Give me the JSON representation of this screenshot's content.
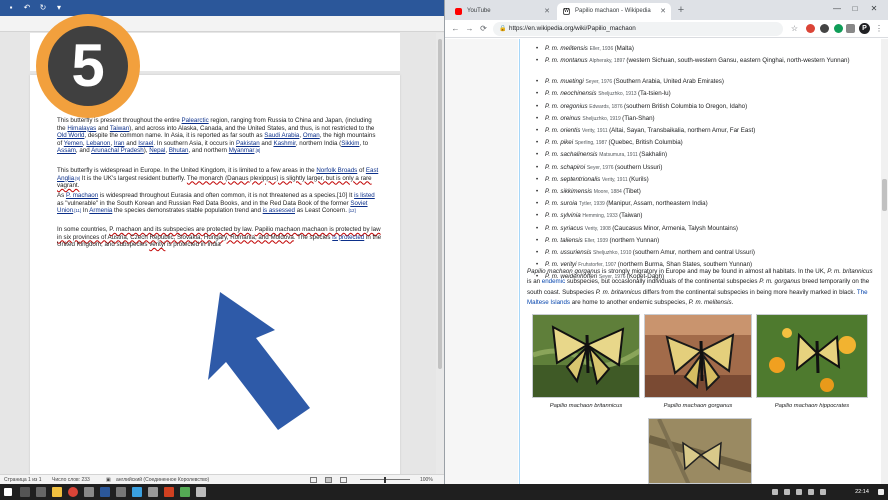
{
  "word": {
    "statusbar": {
      "page": "Страница 1 из 1",
      "words": "Число слов: 233",
      "language": "английский (Соединенное Королевство)",
      "zoom": "100%"
    },
    "paragraphs": [
      [
        {
          "t": "This butterfly is present throughout the entire "
        },
        {
          "t": "Palearctic",
          "c": "lnk"
        },
        {
          "t": " region, ranging from Russia to China and Japan, (including the "
        },
        {
          "t": "Himalayas",
          "c": "lnk"
        },
        {
          "t": " and "
        },
        {
          "t": "Taiwan",
          "c": "lnk"
        },
        {
          "t": "), and across into Alaska, Canada, and the United States, and thus, is not restricted to the "
        },
        {
          "t": "Old World",
          "c": "lnk"
        },
        {
          "t": ", despite the common name. In Asia, it is reported as far south as "
        },
        {
          "t": "Saudi Arabia",
          "c": "lnk"
        },
        {
          "t": ", "
        },
        {
          "t": "Oman",
          "c": "lnk"
        },
        {
          "t": ", the high mountains of "
        },
        {
          "t": "Yemen",
          "c": "lnk"
        },
        {
          "t": ", "
        },
        {
          "t": "Lebanon",
          "c": "lnk"
        },
        {
          "t": ", "
        },
        {
          "t": "Iran",
          "c": "lnk"
        },
        {
          "t": " and "
        },
        {
          "t": "Israel",
          "c": "lnk"
        },
        {
          "t": ". In southern Asia, it occurs in "
        },
        {
          "t": "Pakistan",
          "c": "lnk"
        },
        {
          "t": " and "
        },
        {
          "t": "Kashmir",
          "c": "lnk"
        },
        {
          "t": ", northern India ("
        },
        {
          "t": "Sikkim",
          "c": "lnk"
        },
        {
          "t": ", to "
        },
        {
          "t": "Assam",
          "c": "lnk"
        },
        {
          "t": ", and "
        },
        {
          "t": "Arunachal Pradesh",
          "c": "lnk"
        },
        {
          "t": "), "
        },
        {
          "t": "Nepal",
          "c": "lnk"
        },
        {
          "t": ", "
        },
        {
          "t": "Bhutan",
          "c": "lnk"
        },
        {
          "t": ", and northern "
        },
        {
          "t": "Myanmar",
          "c": "lnk"
        },
        {
          "t": ".[8]",
          "c": "sup"
        }
      ],
      [
        {
          "t": "This butterfly is widespread in Europe. In the United Kingdom, it is limited to a few areas in the "
        },
        {
          "t": "Norfolk Broads",
          "c": "lnk"
        },
        {
          "t": " of "
        },
        {
          "t": "East Anglia",
          "c": "lnk"
        },
        {
          "t": ".[9]",
          "c": "sup"
        },
        {
          "t": " It is the UK's largest resident butterfly. "
        },
        {
          "t": "The monarch (Danaus plexippus) is slightly larger, but is only a rare vagrant.",
          "c": "err"
        }
      ],
      [
        {
          "t": "As "
        },
        {
          "t": "P. machaon",
          "c": "lnk"
        },
        {
          "t": " is widespread throughout Eurasia and often common, it is not threatened as a species.[10]",
          "c": "plain"
        },
        {
          "t": " It "
        },
        {
          "t": "is listed",
          "c": "lnk"
        },
        {
          "t": " as \"vulnerable\" in the South Korean and Russian Red Data Books, and in the Red Data Book of the former "
        },
        {
          "t": "Soviet Union",
          "c": "lnk"
        },
        {
          "t": ".[11]",
          "c": "sup"
        },
        {
          "t": " In "
        },
        {
          "t": "Armenia",
          "c": "lnk"
        },
        {
          "t": " the species demonstrates stable population trend and "
        },
        {
          "t": "is assessed",
          "c": "lnk"
        },
        {
          "t": " as Least Concern. "
        },
        {
          "t": "[12]",
          "c": "sup"
        }
      ],
      [
        {
          "t": "In some countries, "
        },
        {
          "t": "P. machaon and its subspecies are protected by law",
          "c": "err"
        },
        {
          "t": ". "
        },
        {
          "t": "Papilio machaon machaon is protected by law in six provinces of Austria, Czech Republic, Slovakia, Hungary, Romania, and Moldova",
          "c": "err"
        },
        {
          "t": ". The species "
        },
        {
          "t": "is protected",
          "c": "lnk"
        },
        {
          "t": " in the United Kingdom, and subspecies "
        },
        {
          "t": "verityi",
          "c": "err"
        },
        {
          "t": " is protected in India"
        }
      ]
    ]
  },
  "badge": {
    "number": "5"
  },
  "browser": {
    "tabs": [
      {
        "label": "YouTube",
        "active": false
      },
      {
        "label": "Papilio machaon - Wikipedia",
        "active": true
      }
    ],
    "url": "https://en.wikipedia.org/wiki/Papilio_machaon"
  },
  "wikipedia": {
    "subspecies": [
      {
        "name": "P. m. melitensis",
        "auth": "Eller, 1936",
        "loc": "(Malta)"
      },
      {
        "name": "P. m. montanus",
        "auth": "Alpheraky, 1897",
        "loc": "(western Sichuan, south-western Gansu, eastern Qinghai, north-western Yunnan)"
      },
      {
        "name": "P. m. muetingi",
        "auth": "Seyer, 1976",
        "loc": "(Southern Arabia, United Arab Emirates)"
      },
      {
        "name": "P. m. neochinensis",
        "auth": "Sheljuzhko, 1913",
        "loc": "(Ta-tsien-lu)"
      },
      {
        "name": "P. m. oregonius",
        "auth": "Edwards, 1876",
        "loc": "(southern British Columbia to Oregon, Idaho)"
      },
      {
        "name": "P. m. oreinus",
        "auth": "Sheljuzhko, 1919",
        "loc": "(Tian-Shan)"
      },
      {
        "name": "P. m. orientis",
        "auth": "Verity, 1911",
        "loc": "(Altai, Sayan, Transbaikalia, northern Amur, Far East)"
      },
      {
        "name": "P. m. pikei",
        "auth": "Sperling, 1987",
        "loc": "(Quebec, British Columbia)"
      },
      {
        "name": "P. m. sachalinensis",
        "auth": "Matsumura, 1911",
        "loc": "(Sakhalin)"
      },
      {
        "name": "P. m. schapiroi",
        "auth": "Seyer, 1976",
        "loc": "(southern Ussuri)"
      },
      {
        "name": "P. m. septentrionalis",
        "auth": "Verity, 1911",
        "loc": "(Kurils)"
      },
      {
        "name": "P. m. sikkimensis",
        "auth": "Moore, 1884",
        "loc": "(Tibet)"
      },
      {
        "name": "P. m. suroia",
        "auth": "Tytler, 1939",
        "loc": "(Manipur, Assam, northeastern India)"
      },
      {
        "name": "P. m. sylvinia",
        "auth": "Hemming, 1933",
        "loc": "(Taiwan)"
      },
      {
        "name": "P. m. syriacus",
        "auth": "Verity, 1908",
        "loc": "(Caucasus Minor, Armenia, Talysh Mountains)"
      },
      {
        "name": "P. m. taliensis",
        "auth": "Eller, 1939",
        "loc": "(northern Yunnan)"
      },
      {
        "name": "P. m. ussuriensis",
        "auth": "Sheljuzhko, 1910",
        "loc": "(southern Amur, northern and central Ussuri)"
      },
      {
        "name": "P. m. verityi",
        "auth": "Fruhstorfer, 1907",
        "loc": "(northern Burma, Shan States, southern Yunnan)"
      },
      {
        "name": "P. m. weidenhofferi",
        "auth": "Seyer, 1976",
        "loc": "(Kopet-Dagh)"
      }
    ],
    "gorganus_para": [
      {
        "t": "Papilio machaon gorganus",
        "i": true
      },
      {
        "t": " is strongly migratory in Europe and may be found in almost all habitats. In the UK, "
      },
      {
        "t": "P. m. britannicus",
        "i": true
      },
      {
        "t": " is an "
      },
      {
        "t": "endemic",
        "c": "lnk"
      },
      {
        "t": " subspecies, but occasionally individuals of the continental subspecies "
      },
      {
        "t": "P. m. gorganus",
        "i": true
      },
      {
        "t": " breed temporarily on the south coast. Subspecies "
      },
      {
        "t": "P. m. britannicus",
        "i": true
      },
      {
        "t": " differs from the continental subspecies in being more heavily marked in black. "
      },
      {
        "t": "The Maltese Islands",
        "c": "lnk"
      },
      {
        "t": " are home to another endemic subspecies, "
      },
      {
        "t": "P. m. melitensis",
        "i": true
      },
      {
        "t": "."
      }
    ],
    "gallery": [
      {
        "caption": "Papilio machaon britannicus"
      },
      {
        "caption": "Papilio machaon gorganus"
      },
      {
        "caption": "Papilio machaon hippocrates"
      }
    ]
  },
  "taskbar": {
    "time": "22:14"
  },
  "colors": {
    "word_blue": "#2b579a",
    "badge_orange": "#f2a03d",
    "arrow_blue": "#2e5aa8",
    "wiki_link": "#0645ad"
  }
}
